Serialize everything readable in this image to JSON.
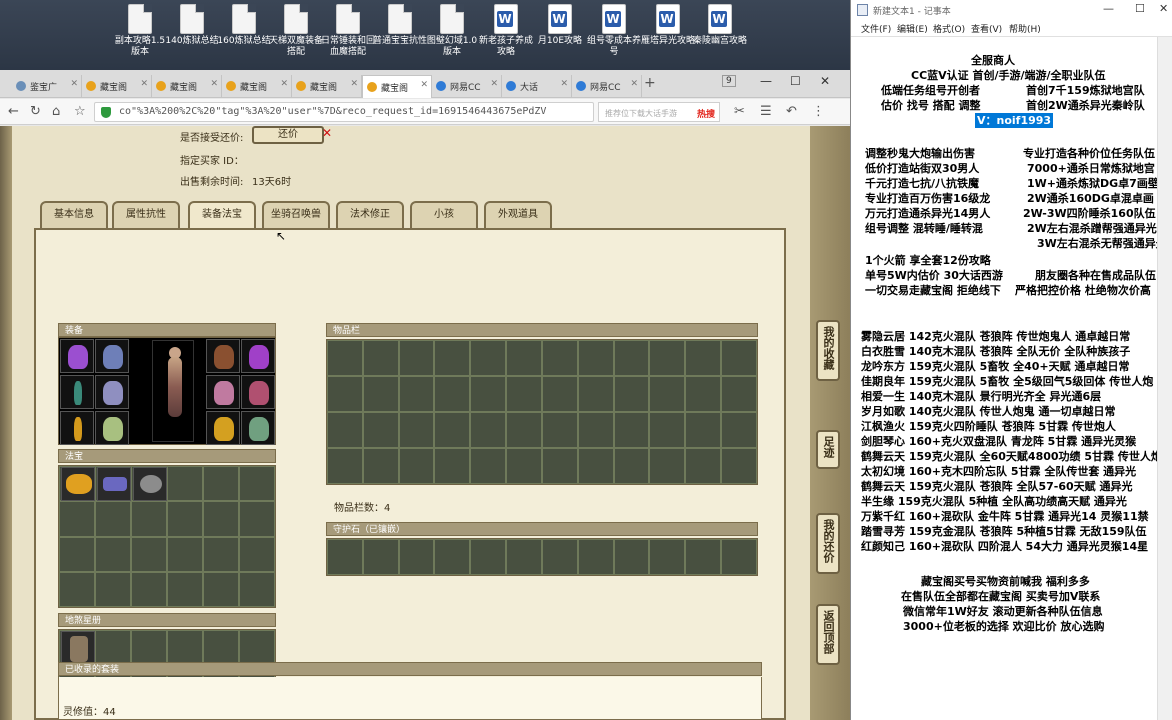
{
  "desktop": {
    "icons": [
      {
        "label": "副本攻略1.5版本",
        "type": "file"
      },
      {
        "label": "140炼狱总结",
        "type": "file"
      },
      {
        "label": "160炼狱总结",
        "type": "file"
      },
      {
        "label": "天梯双魔装备搭配",
        "type": "file"
      },
      {
        "label": "日常锤装和回血魔搭配",
        "type": "file"
      },
      {
        "label": "普通宝宝抗性",
        "type": "file"
      },
      {
        "label": "图璧幻域1.0版本",
        "type": "file"
      },
      {
        "label": "新老孩子养成攻略",
        "type": "word"
      },
      {
        "label": "月10E攻略",
        "type": "word"
      },
      {
        "label": "组号零成本养号",
        "type": "word"
      },
      {
        "label": "雁塔异光攻略",
        "type": "word"
      },
      {
        "label": "秦陵幽宫攻略",
        "type": "word"
      }
    ]
  },
  "browser": {
    "tabs": [
      {
        "label": "鉴宝广",
        "icon": "globe"
      },
      {
        "label": "藏宝阁",
        "icon": "game"
      },
      {
        "label": "藏宝阁",
        "icon": "game"
      },
      {
        "label": "藏宝阁",
        "icon": "game"
      },
      {
        "label": "藏宝阁",
        "icon": "game"
      },
      {
        "label": "藏宝阁",
        "icon": "game",
        "active": true
      },
      {
        "label": "网易CC",
        "icon": "blue"
      },
      {
        "label": "大话",
        "icon": "blue"
      },
      {
        "label": "网易CC",
        "icon": "blue"
      }
    ],
    "tab_count": "9",
    "address": "co\"%3A%200%2C%20\"tag\"%3A%20\"user\"%7D&reco_request_id=1691546443675ePdZV",
    "search_placeholder": "推荐位下载大话手游",
    "search_hot": "热搜"
  },
  "game": {
    "accept_counter_label": "是否接受还价:",
    "counter_button": "还价",
    "buyer_label": "指定买家 ID：",
    "buyer_value": "",
    "remaining_label": "出售剩余时间:",
    "remaining_value": "13天6时",
    "tabs": [
      "基本信息",
      "属性抗性",
      "装备法宝",
      "坐骑召唤兽",
      "法术修正",
      "小孩",
      "外观道具"
    ],
    "active_tab": 2,
    "sections": {
      "equipment": "装备",
      "fabao": "法宝",
      "dizang": "地煞星册",
      "inventory": "物品栏",
      "guardian": "守护石（已镶嵌）",
      "collected": "已收录的套装"
    },
    "inventory_count_label": "物品栏数：4",
    "lingxiu_label": "灵修值：44",
    "side_buttons": [
      "我的收藏",
      "足迹",
      "我的还价",
      "返回顶部"
    ]
  },
  "notepad": {
    "title": "新建文本1 - 记事本",
    "menu": [
      "文件(F)",
      "编辑(E)",
      "格式(O)",
      "查看(V)",
      "帮助(H)"
    ],
    "lines": [
      "全服商人",
      "CC蓝V认证  首创/手游/端游/全职业队伍",
      "低端任务组号开创者",
      "首创7千159炼狱地宫队",
      "估价 找号 搭配 调整",
      "首创2W通杀异光秦岭队",
      "V：noif1993",
      "调整秒鬼大炮输出伤害",
      "专业打造各种价位任务队伍",
      "低价打造站街双30男人",
      "7000+通杀日常炼狱地宫",
      "千元打造七抗/八抗铁魔",
      "1W+通杀炼狱DG卓7画壁",
      "专业打造百万伤害16级龙",
      "2W通杀160DG卓混卓画",
      "万元打造通杀异光14男人",
      "2W-3W四阶睡杀160队伍",
      "组号调整 混转睡/睡转混",
      "2W左右混杀蹭帮强通异光",
      "3W左右混杀无帮强通异光",
      "1个火箭 享全套12份攻略",
      "单号5W内估价 30大话西游",
      "朋友圈各种在售成品队伍",
      "一切交易走藏宝阁 拒绝线下",
      "严格把控价格 杜绝物次价高",
      "雾隐云居 142克火混队 苍狼阵 传世炮鬼人 通卓越日常",
      "白衣胜雪 140克木混队 苍狼阵 全队无价 全队种族孩子",
      "龙吟东方 159克火混队 5畜牧 全40+天赋 通卓越日常",
      "佳期良年 159克火混队 5畜牧 全5级回气5级回体 传世人炮",
      "相爱一生 140克木混队 景行明光齐全 异光通6层",
      "岁月如歌 140克火混队 传世人炮鬼 通一切卓越日常",
      "江枫渔火 159克火四阶睡队 苍狼阵 5甘霖 传世炮人",
      "剑胆琴心 160+克火双盘混队 青龙阵 5甘霖 通异光灵猴",
      "鹤舞云天 159克火混队 全60天赋4800功绩 5甘霖 传世人炮",
      "太初幻境 160+克木四阶忘队 5甘霖 全队传世套 通异光",
      "鹤舞云天 159克火混队 苍狼阵 全队57-60天赋 通异光",
      "半生缘   159克火混队 5种植 全队高功绩高天赋 通异光",
      "万紫千红 160+混砍队 金牛阵 5甘霖 通异光14 灵猴11禁",
      "踏雪寻芳 159克金混队 苍狼阵 5种植5甘霖 无敌159队伍",
      "红颜知己 160+混砍队 四阶混人 54大力 通异光灵猴14星",
      "藏宝阁买号买物资前喊我 福利多多",
      "在售队伍全部都在藏宝阁 买卖号加V联系",
      "微信常年1W好友 滚动更新各种队伍信息",
      "3000+位老板的选择 欢迎比价 放心选购"
    ]
  }
}
